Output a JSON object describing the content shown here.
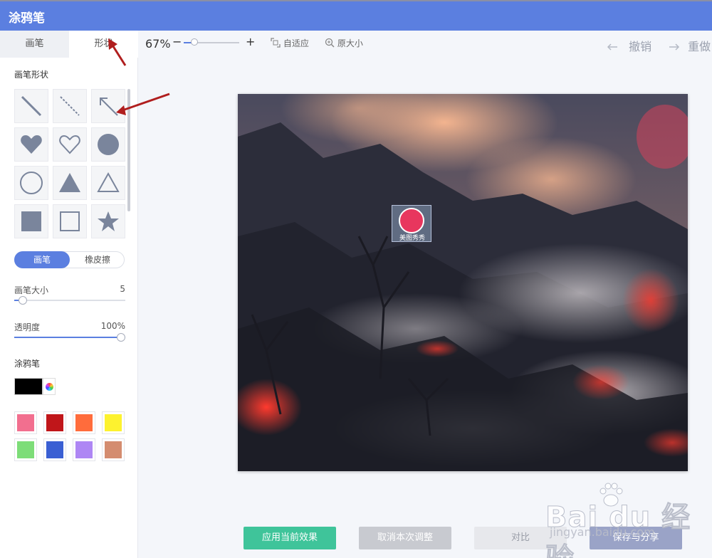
{
  "app": {
    "title": "涂鸦笔"
  },
  "tabs": [
    {
      "label": "画笔"
    },
    {
      "label": "形状"
    }
  ],
  "shapes": {
    "heading": "画笔形状",
    "items": [
      "line-icon",
      "dashed-line-icon",
      "arrow-icon",
      "heart-icon",
      "heart-outline-icon",
      "circle-icon",
      "circle-outline-icon",
      "triangle-icon",
      "triangle-outline-icon",
      "square-icon",
      "square-outline-icon",
      "star-icon"
    ]
  },
  "mode": {
    "brush": "画笔",
    "eraser": "橡皮擦",
    "selected": "brush"
  },
  "brush_size": {
    "label": "画笔大小",
    "value": "5",
    "level": 0.04
  },
  "opacity": {
    "label": "透明度",
    "value": "100%",
    "level": 1.0
  },
  "color": {
    "label": "涂鸦笔",
    "current": "#000000",
    "palette": [
      "#f26f8f",
      "#c0161a",
      "#ff6c3c",
      "#fdf22f",
      "#7ddd78",
      "#3a5fd3",
      "#ae86f4",
      "#d48c6f"
    ]
  },
  "toolbar": {
    "zoom": "67%",
    "zoom_level": 0.18,
    "minus": "−",
    "plus": "+",
    "fit": "自适应",
    "original": "原大小",
    "undo": "撤销",
    "redo": "重做"
  },
  "desktop_icon": {
    "label": "美图秀秀"
  },
  "buttons": {
    "apply": "应用当前效果",
    "cancel": "取消本次调整",
    "compare": "对比",
    "save": "保存与分享"
  },
  "watermark": {
    "brand": "Bai du 经验",
    "url": "jingyan.baidu.com"
  },
  "colors": {
    "accent": "#5b7fe0",
    "apply": "#3fc49a",
    "shape": "#7a859c"
  }
}
